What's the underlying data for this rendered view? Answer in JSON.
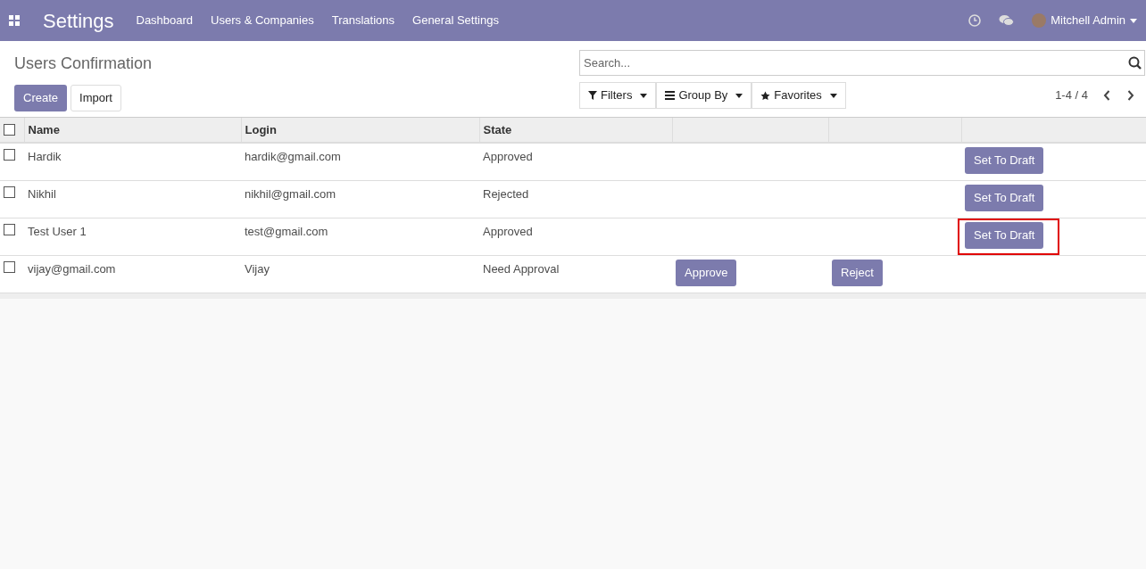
{
  "navbar": {
    "app_title": "Settings",
    "menu": [
      "Dashboard",
      "Users & Companies",
      "Translations",
      "General Settings"
    ],
    "user": "Mitchell Admin"
  },
  "control_panel": {
    "title": "Users Confirmation",
    "buttons": [
      {
        "label": "Create",
        "kind": "primary"
      },
      {
        "label": "Import",
        "kind": "secondary"
      }
    ],
    "search": {
      "placeholder": "Search..."
    },
    "filters": [
      {
        "label": "Filters",
        "kind": "filter"
      },
      {
        "label": "Group By",
        "kind": "group"
      },
      {
        "label": "Favorites",
        "kind": "star"
      }
    ],
    "pager": "1-4 / 4"
  },
  "table": {
    "select_all_checked": false,
    "columns": [
      "Name",
      "Login",
      "State"
    ],
    "rows": [
      {
        "checked": false,
        "cells": [
          "Hardik",
          "hardik@gmail.com",
          "Approved"
        ],
        "column_6": {
          "label": "Set To Draft",
          "highlighted": false
        }
      },
      {
        "checked": false,
        "cells": [
          "Nikhil",
          "nikhil@gmail.com",
          "Rejected"
        ],
        "column_6": {
          "label": "Set To Draft",
          "highlighted": false
        }
      },
      {
        "checked": false,
        "cells": [
          "Test User 1",
          "test@gmail.com",
          "Approved"
        ],
        "column_6": {
          "label": "Set To Draft",
          "highlighted": true
        }
      },
      {
        "checked": false,
        "cells": [
          "vijay@gmail.com",
          "Vijay",
          "Need Approval"
        ],
        "column_4": {
          "label": "Approve",
          "highlighted": false
        },
        "column_5": {
          "label": "Reject",
          "highlighted": false
        }
      }
    ]
  }
}
